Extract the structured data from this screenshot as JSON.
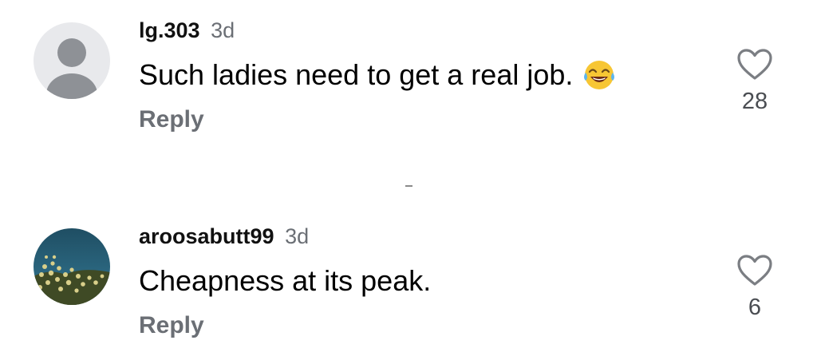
{
  "comments": [
    {
      "username": "lg.303",
      "time": "3d",
      "text": "Such ladies need to get a real job.",
      "emoji": "face-with-tears-of-joy",
      "reply_label": "Reply",
      "like_count": "28",
      "avatar": "default-avatar-icon"
    },
    {
      "username": "aroosabutt99",
      "time": "3d",
      "text": "Cheapness at its peak.",
      "reply_label": "Reply",
      "like_count": "6",
      "avatar": "flowers-photo-avatar"
    }
  ],
  "colors": {
    "secondary_text": "#6b6f75",
    "avatar_bg": "#e8e9ec",
    "avatar_fg": "#8e9196",
    "heart_stroke": "#7b7e83"
  }
}
